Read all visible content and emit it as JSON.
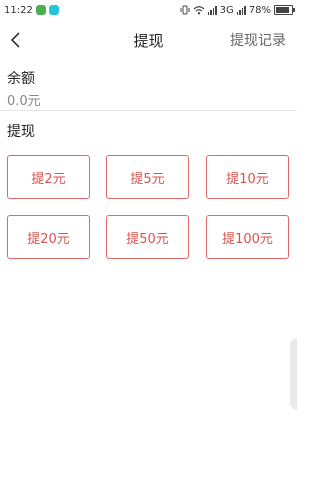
{
  "status_bar": {
    "time": "11:22",
    "network": "3G",
    "battery": "78%",
    "battery_level": 0.78,
    "app_icon_colors": [
      "#4caf50",
      "#26c6da"
    ]
  },
  "header": {
    "title": "提现",
    "right_link": "提现记录"
  },
  "balance": {
    "label": "余额",
    "value": "0.0元"
  },
  "withdraw": {
    "label": "提现",
    "options": [
      "提2元",
      "提5元",
      "提10元",
      "提20元",
      "提50元",
      "提100元"
    ]
  },
  "colors": {
    "accent": "#d9534f",
    "button_border": "#e06a6a"
  }
}
